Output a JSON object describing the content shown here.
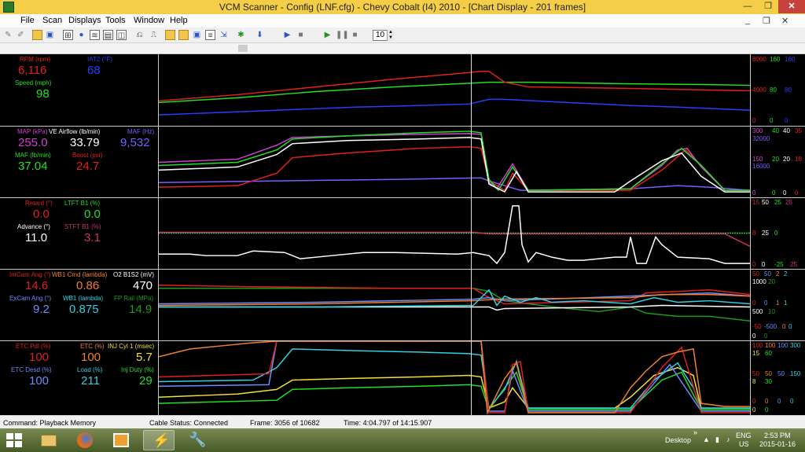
{
  "window": {
    "title": "VCM Scanner  -  Config  (LNF.cfg)  -  Chevy Cobalt (I4) 2010 - [Chart Display  -  201 frames]",
    "min": "—",
    "max": "❐",
    "close": "✕"
  },
  "menu": [
    "File",
    "Scan",
    "Displays",
    "Tools",
    "Window",
    "Help"
  ],
  "mdi_controls": {
    "min": "_",
    "restore": "❐",
    "close": "✕"
  },
  "toolbar": {
    "frame_step": "10"
  },
  "rows": [
    {
      "params": [
        {
          "label": "RPM (rpm)",
          "value": "6,116",
          "color": "#e02020"
        },
        {
          "label": "IAT2 (°F)",
          "value": "68",
          "color": "#2a3cff"
        },
        {
          "label": "Speed (mph)",
          "value": "98",
          "color": "#22e022"
        }
      ],
      "scale": [
        {
          "text": "8000",
          "color": "#e02020"
        },
        {
          "text": "160",
          "color": "#22e022"
        },
        {
          "text": "160",
          "color": "#2a3cff"
        },
        {
          "text": "4000",
          "color": "#e02020"
        },
        {
          "text": "80",
          "color": "#22e022"
        },
        {
          "text": "80",
          "color": "#2a3cff"
        },
        {
          "text": "0",
          "color": "#e02020"
        },
        {
          "text": "0",
          "color": "#22e022"
        },
        {
          "text": "0",
          "color": "#2a3cff"
        }
      ]
    },
    {
      "params": [
        {
          "label": "MAP (kPa)",
          "value": "255.0",
          "color": "#d040d0"
        },
        {
          "label": "VE Airflow (lb/min)",
          "value": "33.79",
          "color": "#ffffff"
        },
        {
          "label": "MAF (Hz)",
          "value": "9,532",
          "color": "#7a5cff"
        },
        {
          "label": "MAF (lb/min)",
          "value": "37.04",
          "color": "#22e022"
        },
        {
          "label": "Boost (psi)",
          "value": "24.7",
          "color": "#e02020"
        }
      ],
      "scale": [
        {
          "text": "300",
          "color": "#d040d0"
        },
        {
          "text": "40",
          "color": "#22e022"
        },
        {
          "text": "40",
          "color": "#ffffff"
        },
        {
          "text": "35",
          "color": "#e02020"
        },
        {
          "text": "32000",
          "color": "#7a5cff"
        },
        {
          "text": "150",
          "color": "#d040d0"
        },
        {
          "text": "20",
          "color": "#22e022"
        },
        {
          "text": "20",
          "color": "#ffffff"
        },
        {
          "text": "18",
          "color": "#e02020"
        },
        {
          "text": "16000",
          "color": "#7a5cff"
        },
        {
          "text": "0",
          "color": "#d040d0"
        },
        {
          "text": "0",
          "color": "#22e022"
        },
        {
          "text": "0",
          "color": "#ffffff"
        },
        {
          "text": "0",
          "color": "#e02020"
        }
      ]
    },
    {
      "params": [
        {
          "label": "Retard (°)",
          "value": "0.0",
          "color": "#e02020"
        },
        {
          "label": "LTFT B1 (%)",
          "value": "0.0",
          "color": "#22e022"
        },
        {
          "label": "Advance (°)",
          "value": "11.0",
          "color": "#ffffff"
        },
        {
          "label": "STFT B1 (%)",
          "value": "3.1",
          "color": "#d03070"
        }
      ],
      "scale": [
        {
          "text": "15",
          "color": "#e02020"
        },
        {
          "text": "50",
          "color": "#ffffff"
        },
        {
          "text": "25",
          "color": "#22e022"
        },
        {
          "text": "25",
          "color": "#d03070"
        },
        {
          "text": "8",
          "color": "#e02020"
        },
        {
          "text": "25",
          "color": "#ffffff"
        },
        {
          "text": "0",
          "color": "#22e022"
        },
        {
          "text": "0",
          "color": "#e02020"
        },
        {
          "text": "0",
          "color": "#ffffff"
        },
        {
          "text": "-25",
          "color": "#22e022"
        },
        {
          "text": "25",
          "color": "#d03070"
        }
      ]
    },
    {
      "params": [
        {
          "label": "IntCam Ang (°)",
          "value": "14.6",
          "color": "#e02020"
        },
        {
          "label": "WB1 Cmd  (lambda)",
          "value": "0.86",
          "color": "#f08030"
        },
        {
          "label": "O2 B1S2 (mV)",
          "value": "470",
          "color": "#ffffff"
        },
        {
          "label": "ExCam Ang (°)",
          "value": "9.2",
          "color": "#6a8cff"
        },
        {
          "label": "WB1 (lambda)",
          "value": "0.875",
          "color": "#30d0e0"
        },
        {
          "label": "FP Rail (MPa)",
          "value": "14.9",
          "color": "#1c9a1c"
        }
      ],
      "scale": [
        {
          "text": "50",
          "color": "#e02020"
        },
        {
          "text": "50",
          "color": "#6a8cff"
        },
        {
          "text": "2",
          "color": "#f08030"
        },
        {
          "text": "2",
          "color": "#30d0e0"
        },
        {
          "text": "1000",
          "color": "#ffffff"
        },
        {
          "text": "20",
          "color": "#1c9a1c"
        },
        {
          "text": "0",
          "color": "#e02020"
        },
        {
          "text": "0",
          "color": "#6a8cff"
        },
        {
          "text": "1",
          "color": "#f08030"
        },
        {
          "text": "1",
          "color": "#30d0e0"
        },
        {
          "text": "500",
          "color": "#ffffff"
        },
        {
          "text": "10",
          "color": "#1c9a1c"
        },
        {
          "text": "-50",
          "color": "#e02020"
        },
        {
          "text": "-500",
          "color": "#6a8cff"
        },
        {
          "text": "0",
          "color": "#f08030"
        },
        {
          "text": "0",
          "color": "#30d0e0"
        },
        {
          "text": "0",
          "color": "#ffffff"
        },
        {
          "text": "0",
          "color": "#1c9a1c"
        }
      ]
    },
    {
      "params": [
        {
          "label": "ETC Pdl (%)",
          "value": "100",
          "color": "#e02020"
        },
        {
          "label": "ETC (%)",
          "value": "100",
          "color": "#f08030"
        },
        {
          "label": "INJ Cyl 1 (msec)",
          "value": "5.7",
          "color": "#f0e030"
        },
        {
          "label": "ETC Desd (%)",
          "value": "100",
          "color": "#6a8cff"
        },
        {
          "label": "Load (%)",
          "value": "211",
          "color": "#30d0e0"
        },
        {
          "label": "Inj Duty (%)",
          "value": "29",
          "color": "#22e022"
        }
      ],
      "scale": [
        {
          "text": "100",
          "color": "#e02020"
        },
        {
          "text": "100",
          "color": "#f08030"
        },
        {
          "text": "100",
          "color": "#6a8cff"
        },
        {
          "text": "300",
          "color": "#30d0e0"
        },
        {
          "text": "15",
          "color": "#f0e030"
        },
        {
          "text": "60",
          "color": "#22e022"
        },
        {
          "text": "50",
          "color": "#e02020"
        },
        {
          "text": "50",
          "color": "#f08030"
        },
        {
          "text": "50",
          "color": "#6a8cff"
        },
        {
          "text": "150",
          "color": "#30d0e0"
        },
        {
          "text": "8",
          "color": "#f0e030"
        },
        {
          "text": "30",
          "color": "#22e022"
        },
        {
          "text": "0",
          "color": "#e02020"
        },
        {
          "text": "0",
          "color": "#f08030"
        },
        {
          "text": "0",
          "color": "#6a8cff"
        },
        {
          "text": "0",
          "color": "#30d0e0"
        },
        {
          "text": "0",
          "color": "#f0e030"
        },
        {
          "text": "0",
          "color": "#22e022"
        }
      ]
    }
  ],
  "status": {
    "command": "Command:  Playback Memory",
    "cable": "Cable Status:  Connected",
    "frame": "Frame:  3056 of 10682",
    "time": "Time:  4:04.797 of 14:15.907"
  },
  "taskbar": {
    "desktop_label": "Desktop",
    "chevrons": "»",
    "lang_top": "ENG",
    "lang_bottom": "US",
    "clock_time": "2:53 PM",
    "clock_date": "2015-01-16"
  }
}
